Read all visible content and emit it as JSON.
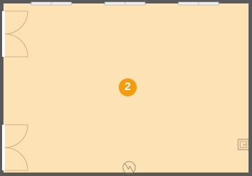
{
  "floor_plan": {
    "room_number": "2",
    "colors": {
      "floor": "#fde2b5",
      "wall": "#5a5a5a",
      "window_frame": "#a9a9a9",
      "door_swing": "#c99a73",
      "badge": "#f39c12",
      "fixture": "#8a7b6a"
    },
    "icons": {
      "hot_water_valve": "valve-icon",
      "power_outlet": "outlet-icon"
    }
  }
}
